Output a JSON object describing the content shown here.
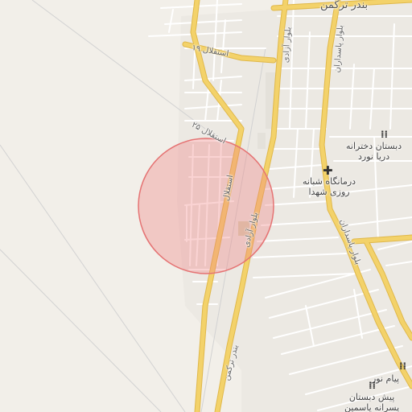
{
  "map": {
    "labels": {
      "girls_school": "دبستان دخترانه\nدریا نورد",
      "clinic": "درمانگاه شبانه\nروزی شهدا",
      "boys_school": "پیش دبستان\nپسرانه یاسمین",
      "payam_noor": "پیام نور",
      "city_top": "بندر ترکمن",
      "esteghlal_19": "استقلال ۱۹",
      "esteghlal_25": "استقلال ۲۵",
      "esteghlal": "استقلال",
      "azadi_blvd_top": "بلوار آزادی",
      "azadi_blvd_mid": "بلوار آزادی",
      "pasdaran_blvd_top": "بلوار پاسداران",
      "pasdaran_blvd_mid": "بلوار پاسداران",
      "bandar_torkaman_road": "بندر ترکمن"
    },
    "icons": {
      "school": "school-icon",
      "clinic": "medical-cross-icon"
    },
    "colors": {
      "background": "#f2efe9",
      "major_road": "#f3d26a",
      "major_road_casing": "#e0b84a",
      "minor_road": "#ffffff",
      "highlight_circle": "#f08080"
    }
  }
}
